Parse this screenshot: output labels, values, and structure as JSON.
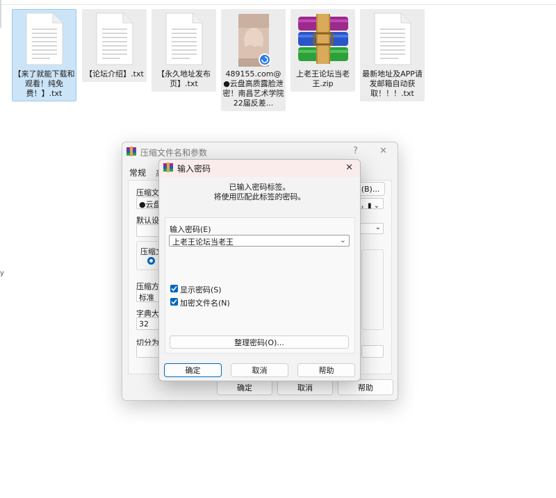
{
  "files": [
    {
      "name": "【来了就能下载和观看！纯免费！】.txt",
      "type": "txt",
      "selected": true
    },
    {
      "name": "【论坛介绍】.txt",
      "type": "txt",
      "selected": false
    },
    {
      "name": "【永久地址发布页】.txt",
      "type": "txt",
      "selected": false
    },
    {
      "name": "489155.com@●云盘高质露脸泄密！南昌艺术学院22届反差...",
      "type": "image",
      "selected": false
    },
    {
      "name": "上老王论坛当老王.zip",
      "type": "zip",
      "selected": false
    },
    {
      "name": "最新地址及APP请发邮箱自动获取！！！.txt",
      "type": "txt",
      "selected": false
    }
  ],
  "side_mark": "y",
  "archive_dialog": {
    "title": "压缩文件名和参数",
    "help_icon": "?",
    "close_icon": "✕",
    "tab_general": "常规",
    "tab_next": "高",
    "archive_name_label": "压缩文件",
    "archive_name_value": "●云盘",
    "browse_button": "(B)...",
    "profile_value": "，▮",
    "default_label": "默认设置",
    "format_label": "压缩文",
    "format_option": "R",
    "method_label": "压缩方式",
    "method_value": "标准",
    "dict_label": "字典大小",
    "dict_value": "32",
    "split_label": "切分为分卷",
    "ok": "确定",
    "cancel": "取消",
    "help": "帮助"
  },
  "password_dialog": {
    "title": "输入密码",
    "close_icon": "✕",
    "info_line1": "已输入密码标签。",
    "info_line2": "将使用匹配此标签的密码。",
    "password_label": "输入密码(E)",
    "password_value": "上老王论坛当老王",
    "show_password": "显示密码(S)",
    "encrypt_names": "加密文件名(N)",
    "organize_button": "整理密码(O)...",
    "ok": "确定",
    "cancel": "取消",
    "help": "帮助"
  },
  "colors": {
    "accent": "#0067c0",
    "selected_tile": "#cce4f7"
  }
}
